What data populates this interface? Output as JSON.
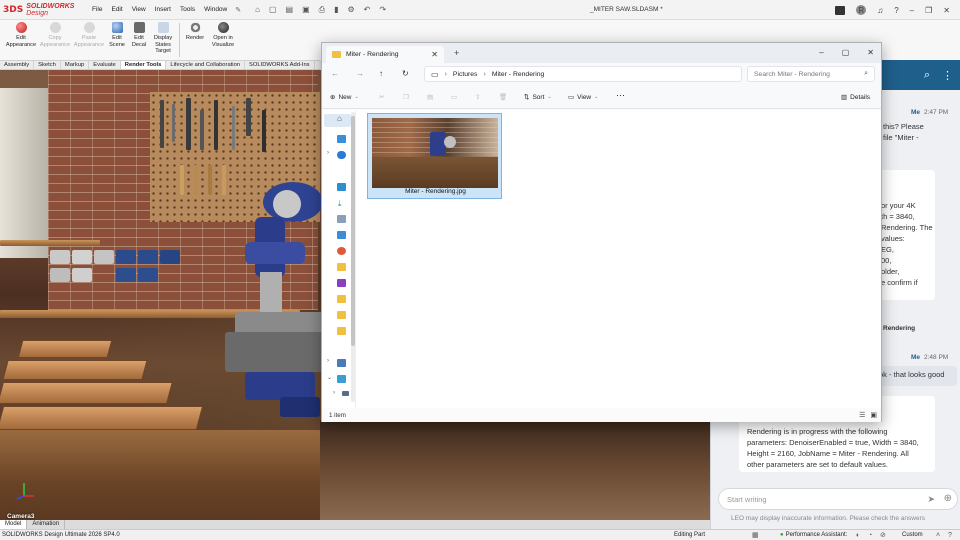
{
  "solidworks": {
    "logo_ds": "3DS",
    "brand": "SOLIDWORKS",
    "brand_suffix": " Design",
    "menu": [
      "File",
      "Edit",
      "View",
      "Insert",
      "Tools",
      "Window"
    ],
    "doc_title": "_MITER SAW.SLDASM *",
    "avatar_initial": "R",
    "ribbon": [
      {
        "label": "Edit Appearance",
        "color": "#e05050",
        "enabled": true
      },
      {
        "label": "Copy Appearance",
        "color": "#c0c0c0",
        "enabled": false
      },
      {
        "label": "Paste Appearance",
        "color": "#c0c0c0",
        "enabled": false
      },
      {
        "label": "Edit Scene",
        "color": "#5a8fd8",
        "enabled": true
      },
      {
        "label": "Edit Decal",
        "color": "#6a6a6a",
        "enabled": true
      },
      {
        "label": "Display States Target",
        "color": "#8aa6c4",
        "enabled": true
      },
      {
        "label": "Render",
        "color": "#777777",
        "enabled": true
      },
      {
        "label": "Open in Visualize",
        "color": "#444444",
        "enabled": true
      }
    ],
    "command_tabs": [
      "Assembly",
      "Sketch",
      "Markup",
      "Evaluate",
      "Render Tools",
      "Lifecycle and Collaboration",
      "SOLIDWORKS Add-Ins"
    ],
    "active_command_tab": "Render Tools",
    "camera_label": "Camera3",
    "model_tabs": [
      "Model",
      "Animation"
    ],
    "status": {
      "product": "SOLIDWORKS Design Ultimate 2026 SP4.0",
      "mode": "Editing Part",
      "performance": "Performance Assistant:",
      "units": "Custom"
    }
  },
  "explorer": {
    "tab_title": "Miter - Rendering",
    "breadcrumb": [
      "Pictures",
      "Miter - Rendering"
    ],
    "search_placeholder": "Search Miter - Rendering",
    "commands": {
      "new": "New",
      "sort": "Sort",
      "view": "View",
      "details": "Details"
    },
    "file": {
      "name": "Miter - Rendering.jpg"
    },
    "item_count": "1 item"
  },
  "leo": {
    "me_label": "Me",
    "messages": [
      {
        "time": "2:47 PM",
        "lines": [
          "this? Please",
          "file \"Miter -"
        ]
      },
      {
        "lines": [
          "or your 4K",
          "th = 3840,",
          "Rendering. The",
          "values:",
          "EG,",
          "00,",
          "older,",
          "e confirm if"
        ]
      },
      {
        "label": "Rendering"
      },
      {
        "time": "2:48 PM",
        "lines": [
          "ok - that looks good"
        ]
      },
      {
        "lines": [
          "Rendering is in progress with the following parameters: DenoiserEnabled = true, Width = 3840, Height = 2160, JobName = Miter - Rendering. All other parameters are set to default values."
        ]
      }
    ],
    "input_placeholder": "Start writing",
    "disclaimer": "LEO may display inaccurate information. Please check the answers"
  },
  "colors": {
    "leo_header": "#1f5f8b",
    "selection": "#cce4f7",
    "sw_red": "#d4262c"
  }
}
